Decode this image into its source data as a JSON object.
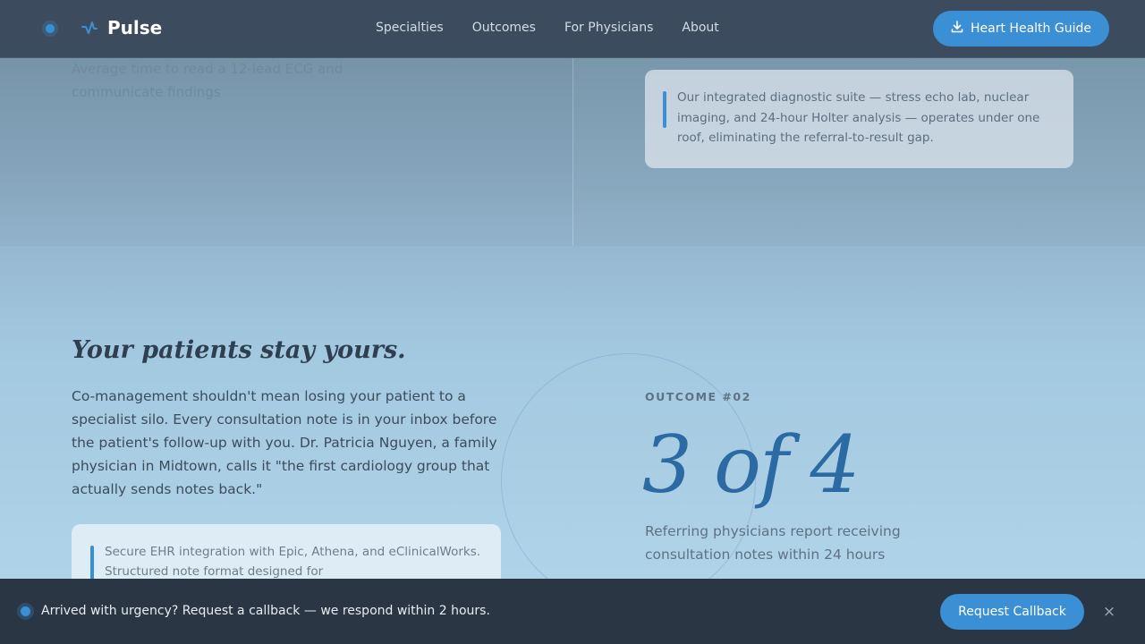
{
  "header": {
    "brand": "Pulse",
    "nav": [
      "Specialties",
      "Outcomes",
      "For Physicians",
      "About"
    ],
    "guide_button": "Heart Health Guide"
  },
  "faded": {
    "text": "Average time to read a 12-lead ECG and communicate findings"
  },
  "quote_card": {
    "text": "Our integrated diagnostic suite — stress echo lab, nuclear imaging, and 24-hour Holter analysis — operates under one roof, eliminating the referral-to-result gap."
  },
  "main": {
    "heading": "Your patients stay yours.",
    "body": "Co-management shouldn't mean losing your patient to a specialist silo. Every consultation note is in your inbox before the patient's follow-up with you. Dr. Patricia Nguyen, a family physician in Midtown, calls it \"the first cardiology group that actually sends notes back.\"",
    "ehr_card": "Secure EHR integration with Epic, Athena, and eClinicalWorks. Structured note format designed for"
  },
  "outcome": {
    "label": "OUTCOME #02",
    "value": "3 of 4",
    "description": "Referring physicians report receiving consultation notes within 24 hours"
  },
  "bottom_bar": {
    "text": "Arrived with urgency? Request a callback — we respond within 2 hours.",
    "callback_button": "Request Callback",
    "close": "×"
  },
  "colors": {
    "accent": "#3b8fd4",
    "header_bg": "#344254",
    "bottom_bg": "#2b3644",
    "outcome_value": "#2c6aa3"
  },
  "icons": {
    "logo": "heartbeat-icon",
    "guide": "download-icon",
    "close": "close-icon"
  }
}
